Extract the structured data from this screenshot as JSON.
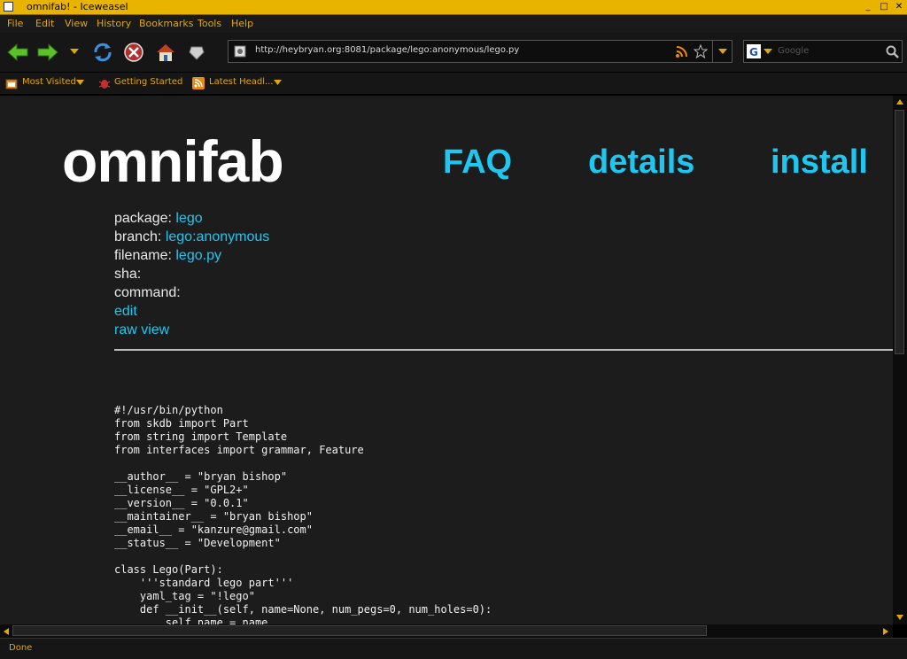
{
  "window": {
    "title": "omnifab! - Iceweasel"
  },
  "menu": [
    "File",
    "Edit",
    "View",
    "History",
    "Bookmarks",
    "Tools",
    "Help"
  ],
  "navbar": {
    "url": "http://heybryan.org:8081/package/lego:anonymous/lego.py",
    "search_placeholder": "Google"
  },
  "bookmarks": [
    {
      "label": "Most Visited"
    },
    {
      "label": "Getting Started"
    },
    {
      "label": "Latest Headl..."
    }
  ],
  "page": {
    "logo": "omnifab",
    "nav": [
      "FAQ",
      "details",
      "install"
    ],
    "meta": {
      "package_label": "package:",
      "package_value": "lego",
      "branch_label": "branch:",
      "branch_value": "lego:anonymous",
      "filename_label": "filename:",
      "filename_value": "lego.py",
      "sha_label": "sha:",
      "command_label": "command:"
    },
    "links": {
      "edit": "edit",
      "raw_view": "raw view"
    },
    "code": "#!/usr/bin/python\nfrom skdb import Part\nfrom string import Template\nfrom interfaces import grammar, Feature\n\n__author__ = \"bryan bishop\"\n__license__ = \"GPL2+\"\n__version__ = \"0.0.1\"\n__maintainer__ = \"bryan bishop\"\n__email__ = \"kanzure@gmail.com\"\n__status__ = \"Development\"\n\nclass Lego(Part):\n    '''standard lego part'''\n    yaml_tag = \"!lego\"\n    def __init__(self, name=None, num_pegs=0, num_holes=0):\n        self.name = name"
  },
  "status": {
    "text": "Done"
  },
  "colors": {
    "accent": "#e0a800",
    "link": "#1ec6f0",
    "background": "#1c1c1c"
  }
}
